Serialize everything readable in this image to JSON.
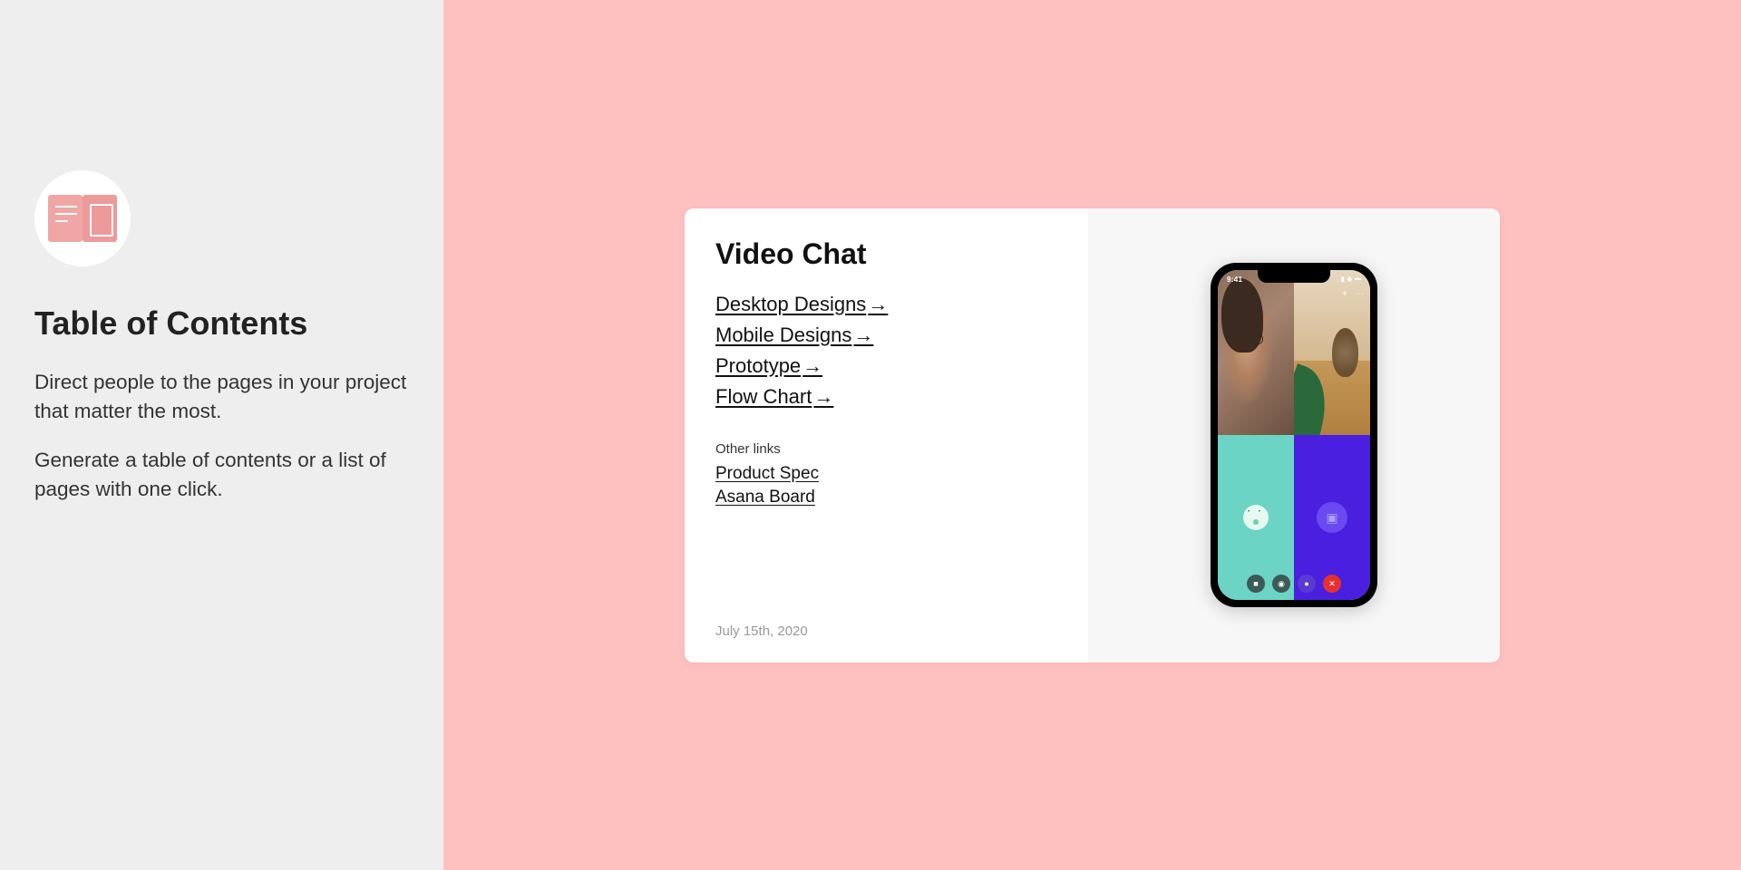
{
  "left": {
    "title": "Table of Contents",
    "desc1": "Direct people to the pages in your project that matter the most.",
    "desc2": "Generate a table of contents or a list of pages with one click."
  },
  "card": {
    "title": "Video Chat",
    "links": {
      "0": "Desktop Designs",
      "1": "Mobile Designs",
      "2": "Prototype",
      "3": "Flow Chart"
    },
    "arrow": "→",
    "other_heading": "Other links",
    "other_links": {
      "0": "Product Spec",
      "1": "Asana Board"
    },
    "date": "July 15th, 2020"
  },
  "phone": {
    "status_time": "9:41"
  },
  "colors": {
    "bg_pink": "#ffc0c0",
    "teal": "#6bd4c4",
    "purple": "#4a1fe0"
  }
}
